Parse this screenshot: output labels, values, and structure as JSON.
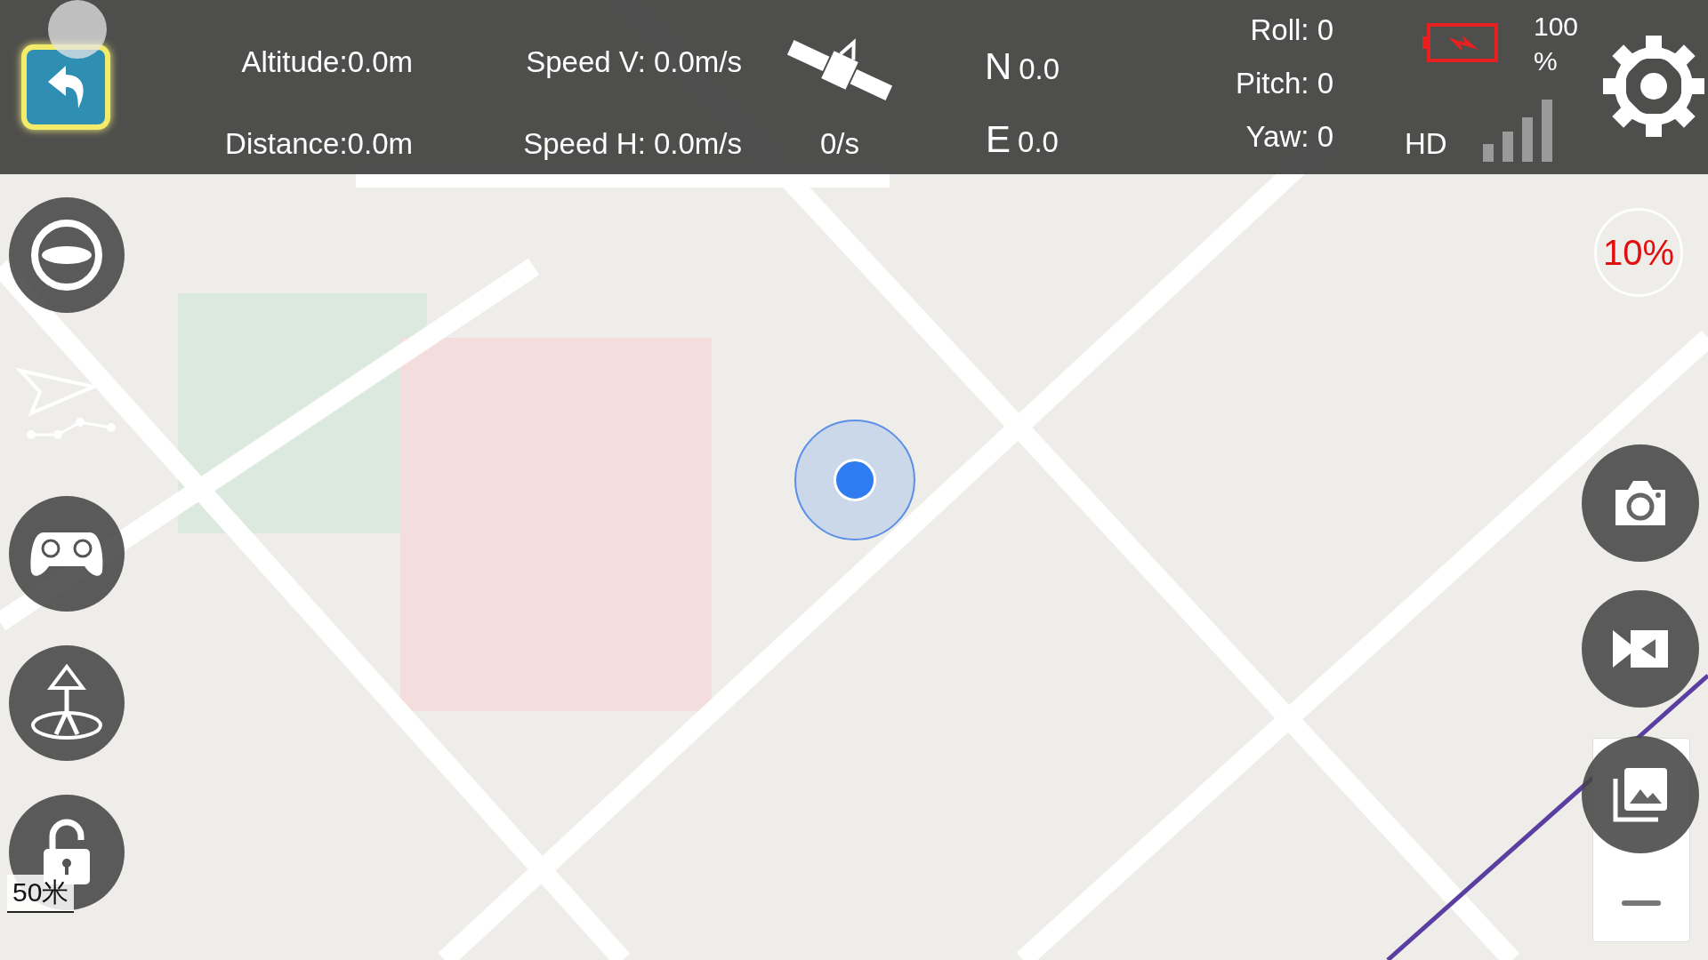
{
  "telemetry": {
    "altitude": "Altitude:0.0m",
    "distance": "Distance:0.0m",
    "speed_v": "Speed V: 0.0m/s",
    "speed_h": "Speed H: 0.0m/s",
    "satellites": "0/s",
    "north": {
      "label": "N",
      "value": "0.0"
    },
    "east": {
      "label": "E",
      "value": "0.0"
    },
    "roll": "Roll: 0",
    "pitch": "Pitch: 0",
    "yaw": "Yaw: 0"
  },
  "battery": {
    "charging": true,
    "reading": "100 %"
  },
  "video": {
    "quality": "HD"
  },
  "left_tools": [
    {
      "kind": "circle"
    },
    {
      "kind": "plain"
    },
    {
      "kind": "circle"
    },
    {
      "kind": "circle"
    },
    {
      "kind": "circle"
    }
  ],
  "right_tools": [
    {
      "kind": "camera"
    },
    {
      "kind": "video"
    },
    {
      "kind": "gallery"
    }
  ],
  "zoom_level": {
    "reading": "10%"
  },
  "map": {
    "scale": "50米"
  }
}
